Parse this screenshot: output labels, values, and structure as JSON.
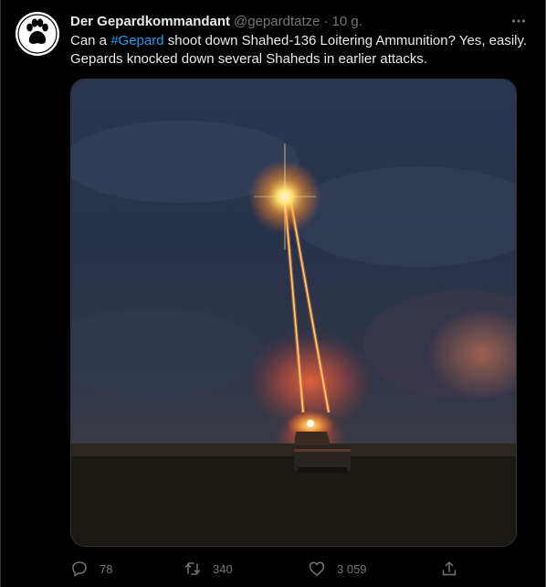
{
  "tweet": {
    "author_name": "Der Gepardkommandant",
    "author_handle": "@gepardtatze",
    "separator": "·",
    "time": "10 g.",
    "text_before": "Can a ",
    "hashtag": "#Gepard",
    "text_after": " shoot down Shahed-136 Loitering Ammunition? Yes, easily. Gepards knocked down several Shaheds in earlier attacks."
  },
  "actions": {
    "reply_count": "78",
    "retweet_count": "340",
    "like_count": "3 059"
  },
  "icons": {
    "avatar": "paw-print-icon",
    "more": "more-horizontal-icon",
    "reply": "reply-icon",
    "retweet": "retweet-icon",
    "like": "heart-icon",
    "share": "share-icon"
  },
  "colors": {
    "background": "#000000",
    "text": "#e7e9ea",
    "secondary": "#71767b",
    "link": "#1d9bf0"
  }
}
